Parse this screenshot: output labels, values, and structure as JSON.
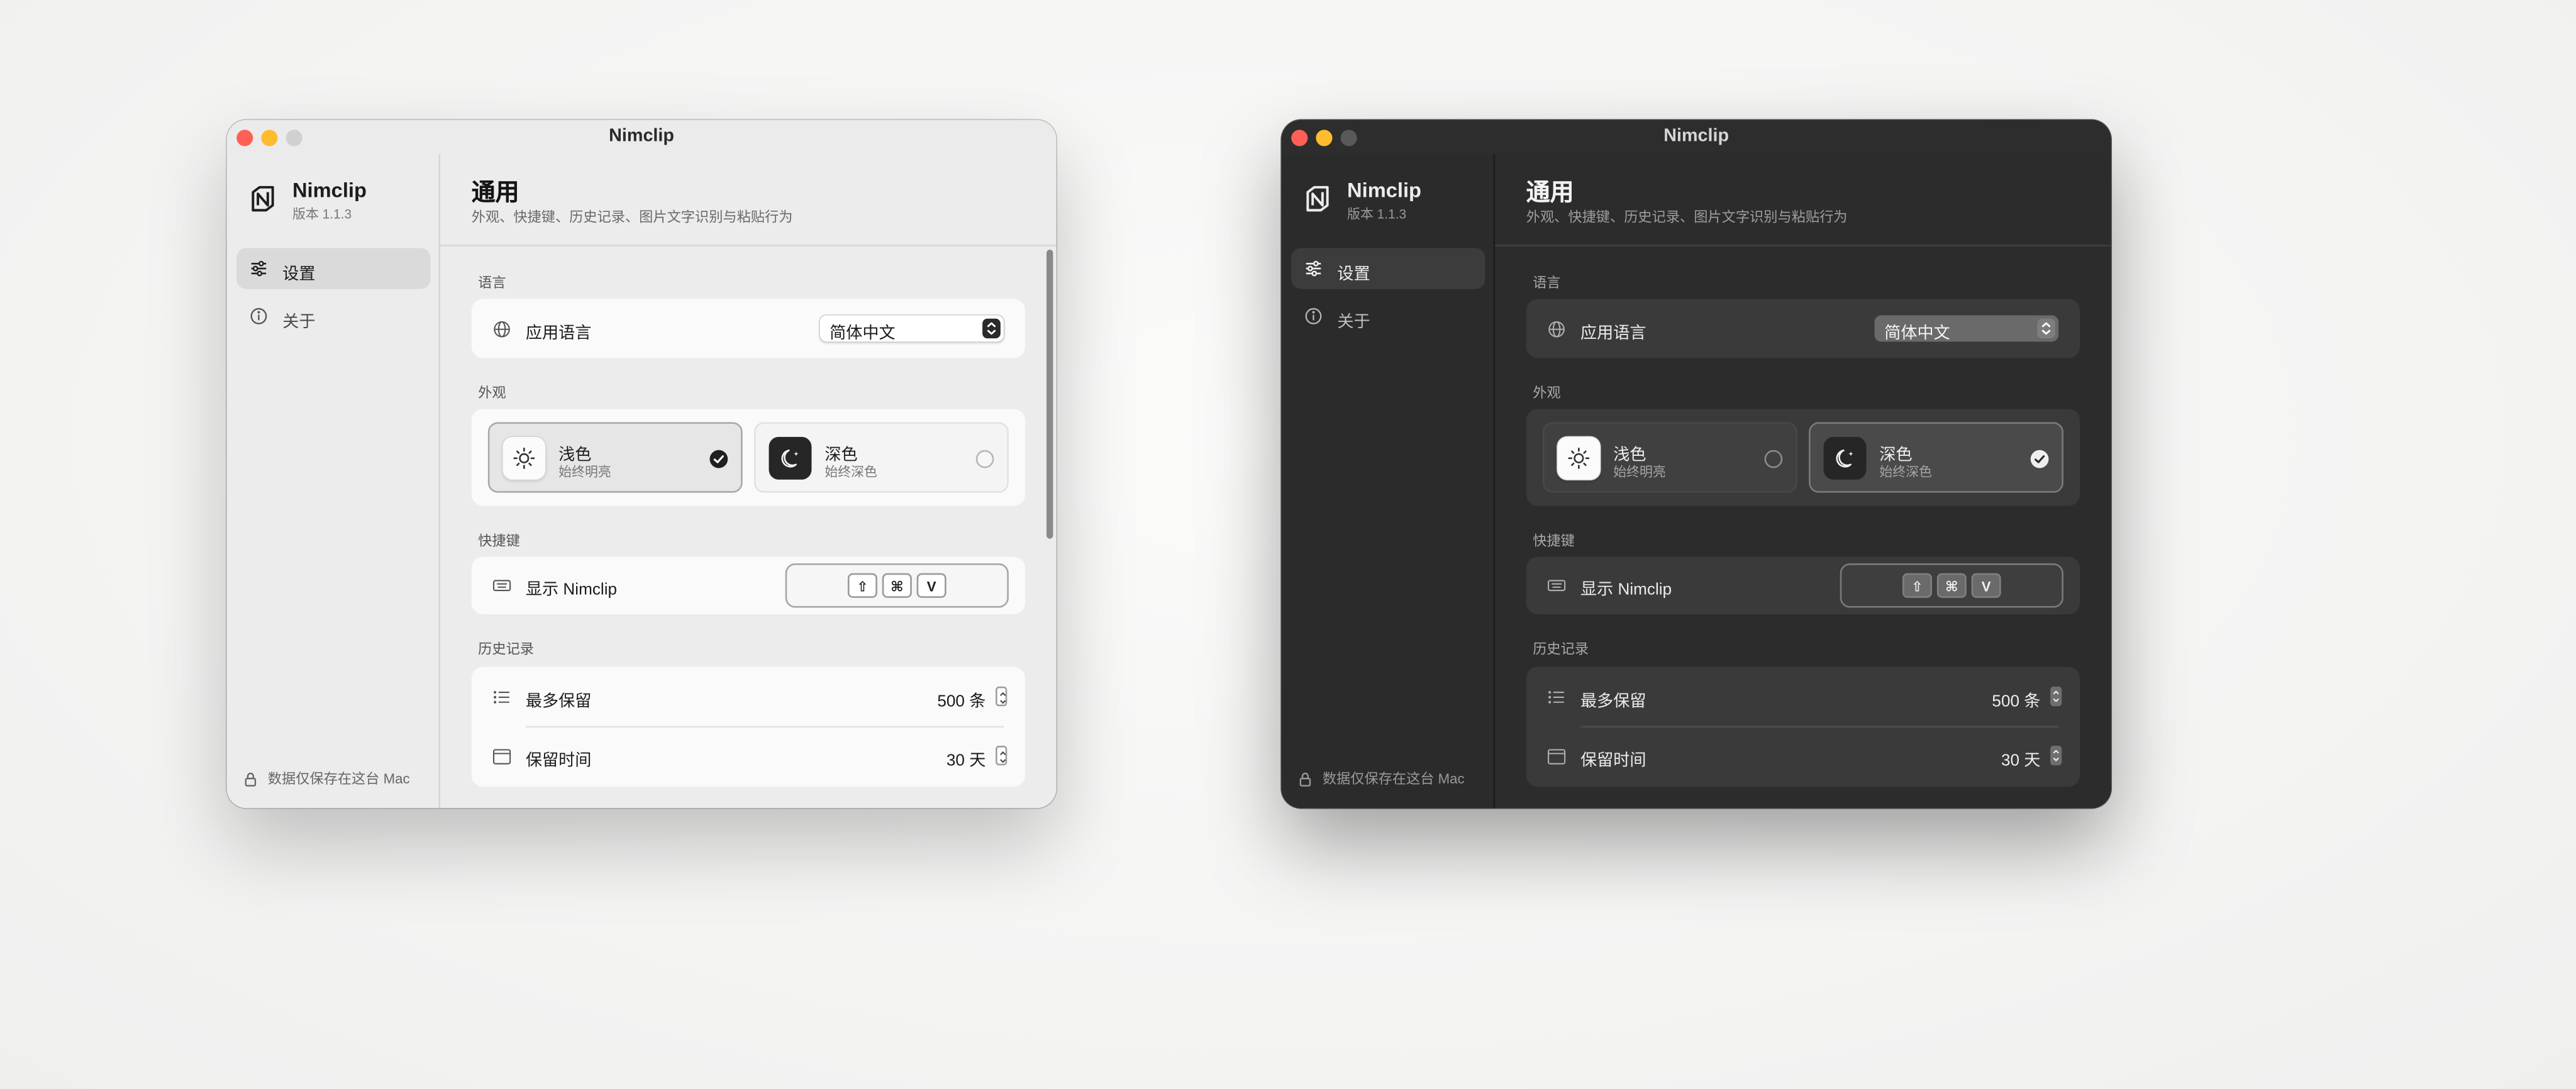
{
  "colors": {
    "accent_close": "#fe5f57",
    "accent_min": "#febc2e",
    "light_bg": "#ececec",
    "dark_bg": "#2c2c2c"
  },
  "windows": [
    {
      "theme": "light",
      "title": "Nimclip",
      "sidebar": {
        "app_name": "Nimclip",
        "app_version": "版本 1.1.3",
        "items": [
          {
            "label": "设置",
            "icon": "sliders-icon",
            "selected": true
          },
          {
            "label": "关于",
            "icon": "info-icon",
            "selected": false
          }
        ],
        "footer": "数据仅保存在这台 Mac"
      },
      "main": {
        "title": "通用",
        "subtitle": "外观、快捷键、历史记录、图片文字识别与粘贴行为",
        "language": {
          "section": "语言",
          "label": "应用语言",
          "value": "简体中文"
        },
        "appearance": {
          "section": "外观",
          "options": [
            {
              "name": "浅色",
              "desc": "始终明亮",
              "selected": true
            },
            {
              "name": "深色",
              "desc": "始终深色",
              "selected": false
            }
          ]
        },
        "shortcut": {
          "section": "快捷键",
          "label": "显示 Nimclip",
          "keys": [
            "⇧",
            "⌘",
            "V"
          ]
        },
        "history": {
          "section": "历史记录",
          "max_label": "最多保留",
          "max_value": "500 条",
          "keep_label": "保留时间",
          "keep_value": "30 天"
        }
      }
    },
    {
      "theme": "dark",
      "title": "Nimclip",
      "sidebar": {
        "app_name": "Nimclip",
        "app_version": "版本 1.1.3",
        "items": [
          {
            "label": "设置",
            "icon": "sliders-icon",
            "selected": true
          },
          {
            "label": "关于",
            "icon": "info-icon",
            "selected": false
          }
        ],
        "footer": "数据仅保存在这台 Mac"
      },
      "main": {
        "title": "通用",
        "subtitle": "外观、快捷键、历史记录、图片文字识别与粘贴行为",
        "language": {
          "section": "语言",
          "label": "应用语言",
          "value": "简体中文"
        },
        "appearance": {
          "section": "外观",
          "options": [
            {
              "name": "浅色",
              "desc": "始终明亮",
              "selected": false
            },
            {
              "name": "深色",
              "desc": "始终深色",
              "selected": true
            }
          ]
        },
        "shortcut": {
          "section": "快捷键",
          "label": "显示 Nimclip",
          "keys": [
            "⇧",
            "⌘",
            "V"
          ]
        },
        "history": {
          "section": "历史记录",
          "max_label": "最多保留",
          "max_value": "500 条",
          "keep_label": "保留时间",
          "keep_value": "30 天"
        }
      }
    }
  ]
}
